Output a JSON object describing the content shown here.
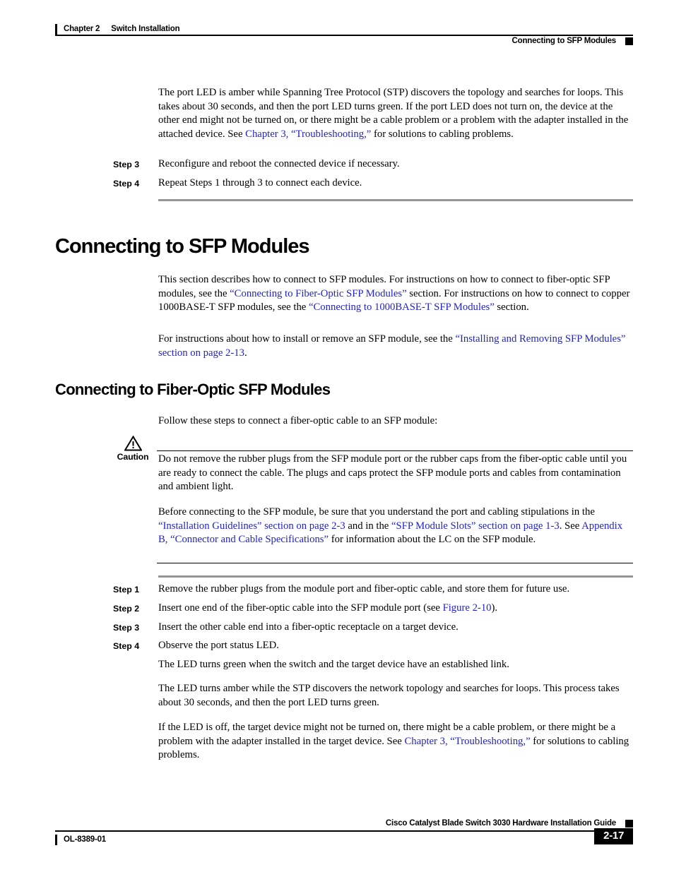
{
  "header": {
    "chapter": "Chapter 2",
    "chapter_title": "Switch Installation",
    "section_title": "Connecting to SFP Modules"
  },
  "body": {
    "intro_paragraph": {
      "seg1": "The port LED is amber while Spanning Tree Protocol (STP) discovers the topology and searches for loops. This takes about 30 seconds, and then the port LED turns green. If the port LED does not turn on, the device at the other end might not be turned on, or there might be a cable problem or a problem with the adapter installed in the attached device. See ",
      "link1": "Chapter 3, “Troubleshooting,”",
      "seg2": " for solutions to cabling problems."
    },
    "steps_top": [
      {
        "label": "Step 3",
        "text": "Reconfigure and reboot the connected device if necessary."
      },
      {
        "label": "Step 4",
        "text": "Repeat Steps 1 through 3 to connect each device."
      }
    ],
    "heading_sfp": "Connecting to SFP Modules",
    "sfp_paragraph": {
      "seg1": "This section describes how to connect to SFP modules. For instructions on how to connect to fiber-optic SFP modules, see the ",
      "link1": "“Connecting to Fiber-Optic SFP Modules”",
      "seg2": " section. For instructions on how to connect to copper 1000BASE-T SFP modules, see the ",
      "link2": "“Connecting to 1000BASE-T SFP Modules”",
      "seg3": " section."
    },
    "sfp_paragraph2": {
      "seg1": "For instructions about how to install or remove an SFP module, see the ",
      "link1": "“Installing and Removing SFP Modules” section on page 2-13",
      "seg2": "."
    },
    "heading_fiber": "Connecting to Fiber-Optic SFP Modules",
    "fiber_intro": "Follow these steps to connect a fiber-optic cable to an SFP module:",
    "caution": {
      "label": "Caution",
      "icon": "warning-triangle-icon",
      "paragraph1": "Do not remove the rubber plugs from the SFP module port or the rubber caps from the fiber-optic cable until you are ready to connect the cable. The plugs and caps protect the SFP module ports and cables from contamination and ambient light.",
      "paragraph2": {
        "seg1": "Before connecting to the SFP module, be sure that you understand the port and cabling stipulations in the ",
        "link1": "“Installation Guidelines” section on page 2-3",
        "seg2": " and in the ",
        "link2": "“SFP Module Slots” section on page 1-3",
        "seg3": ". See ",
        "link3": "Appendix B, “Connector and Cable Specifications”",
        "seg4": " for information about the LC on the SFP module."
      }
    },
    "steps_bottom": [
      {
        "label": "Step 1",
        "seg1": "Remove the rubber plugs from the module port and fiber-optic cable, and store them for future use.",
        "link": "",
        "seg2": ""
      },
      {
        "label": "Step 2",
        "seg1": "Insert one end of the fiber-optic cable into the SFP module port (see ",
        "link": "Figure 2-10",
        "seg2": ")."
      },
      {
        "label": "Step 3",
        "seg1": "Insert the other cable end into a fiber-optic receptacle on a target device.",
        "link": "",
        "seg2": ""
      },
      {
        "label": "Step 4",
        "seg1": "Observe the port status LED.",
        "link": "",
        "seg2": ""
      }
    ],
    "led_paragraph1": "The LED turns green when the switch and the target device have an established link.",
    "led_paragraph2": "The LED turns amber while the STP discovers the network topology and searches for loops. This process takes about 30 seconds, and then the port LED turns green.",
    "led_paragraph3": {
      "seg1": "If the LED is off, the target device might not be turned on, there might be a cable problem, or there might be a problem with the adapter installed in the target device. See ",
      "link1": "Chapter 3, “Troubleshooting,”",
      "seg2": " for solutions to cabling problems."
    }
  },
  "footer": {
    "doc_title": "Cisco Catalyst Blade Switch 3030 Hardware Installation Guide",
    "doc_number": "OL-8389-01",
    "page_number": "2-17"
  },
  "colors": {
    "link": "#2222CC",
    "rule_gray": "#959595",
    "text": "#000000"
  }
}
